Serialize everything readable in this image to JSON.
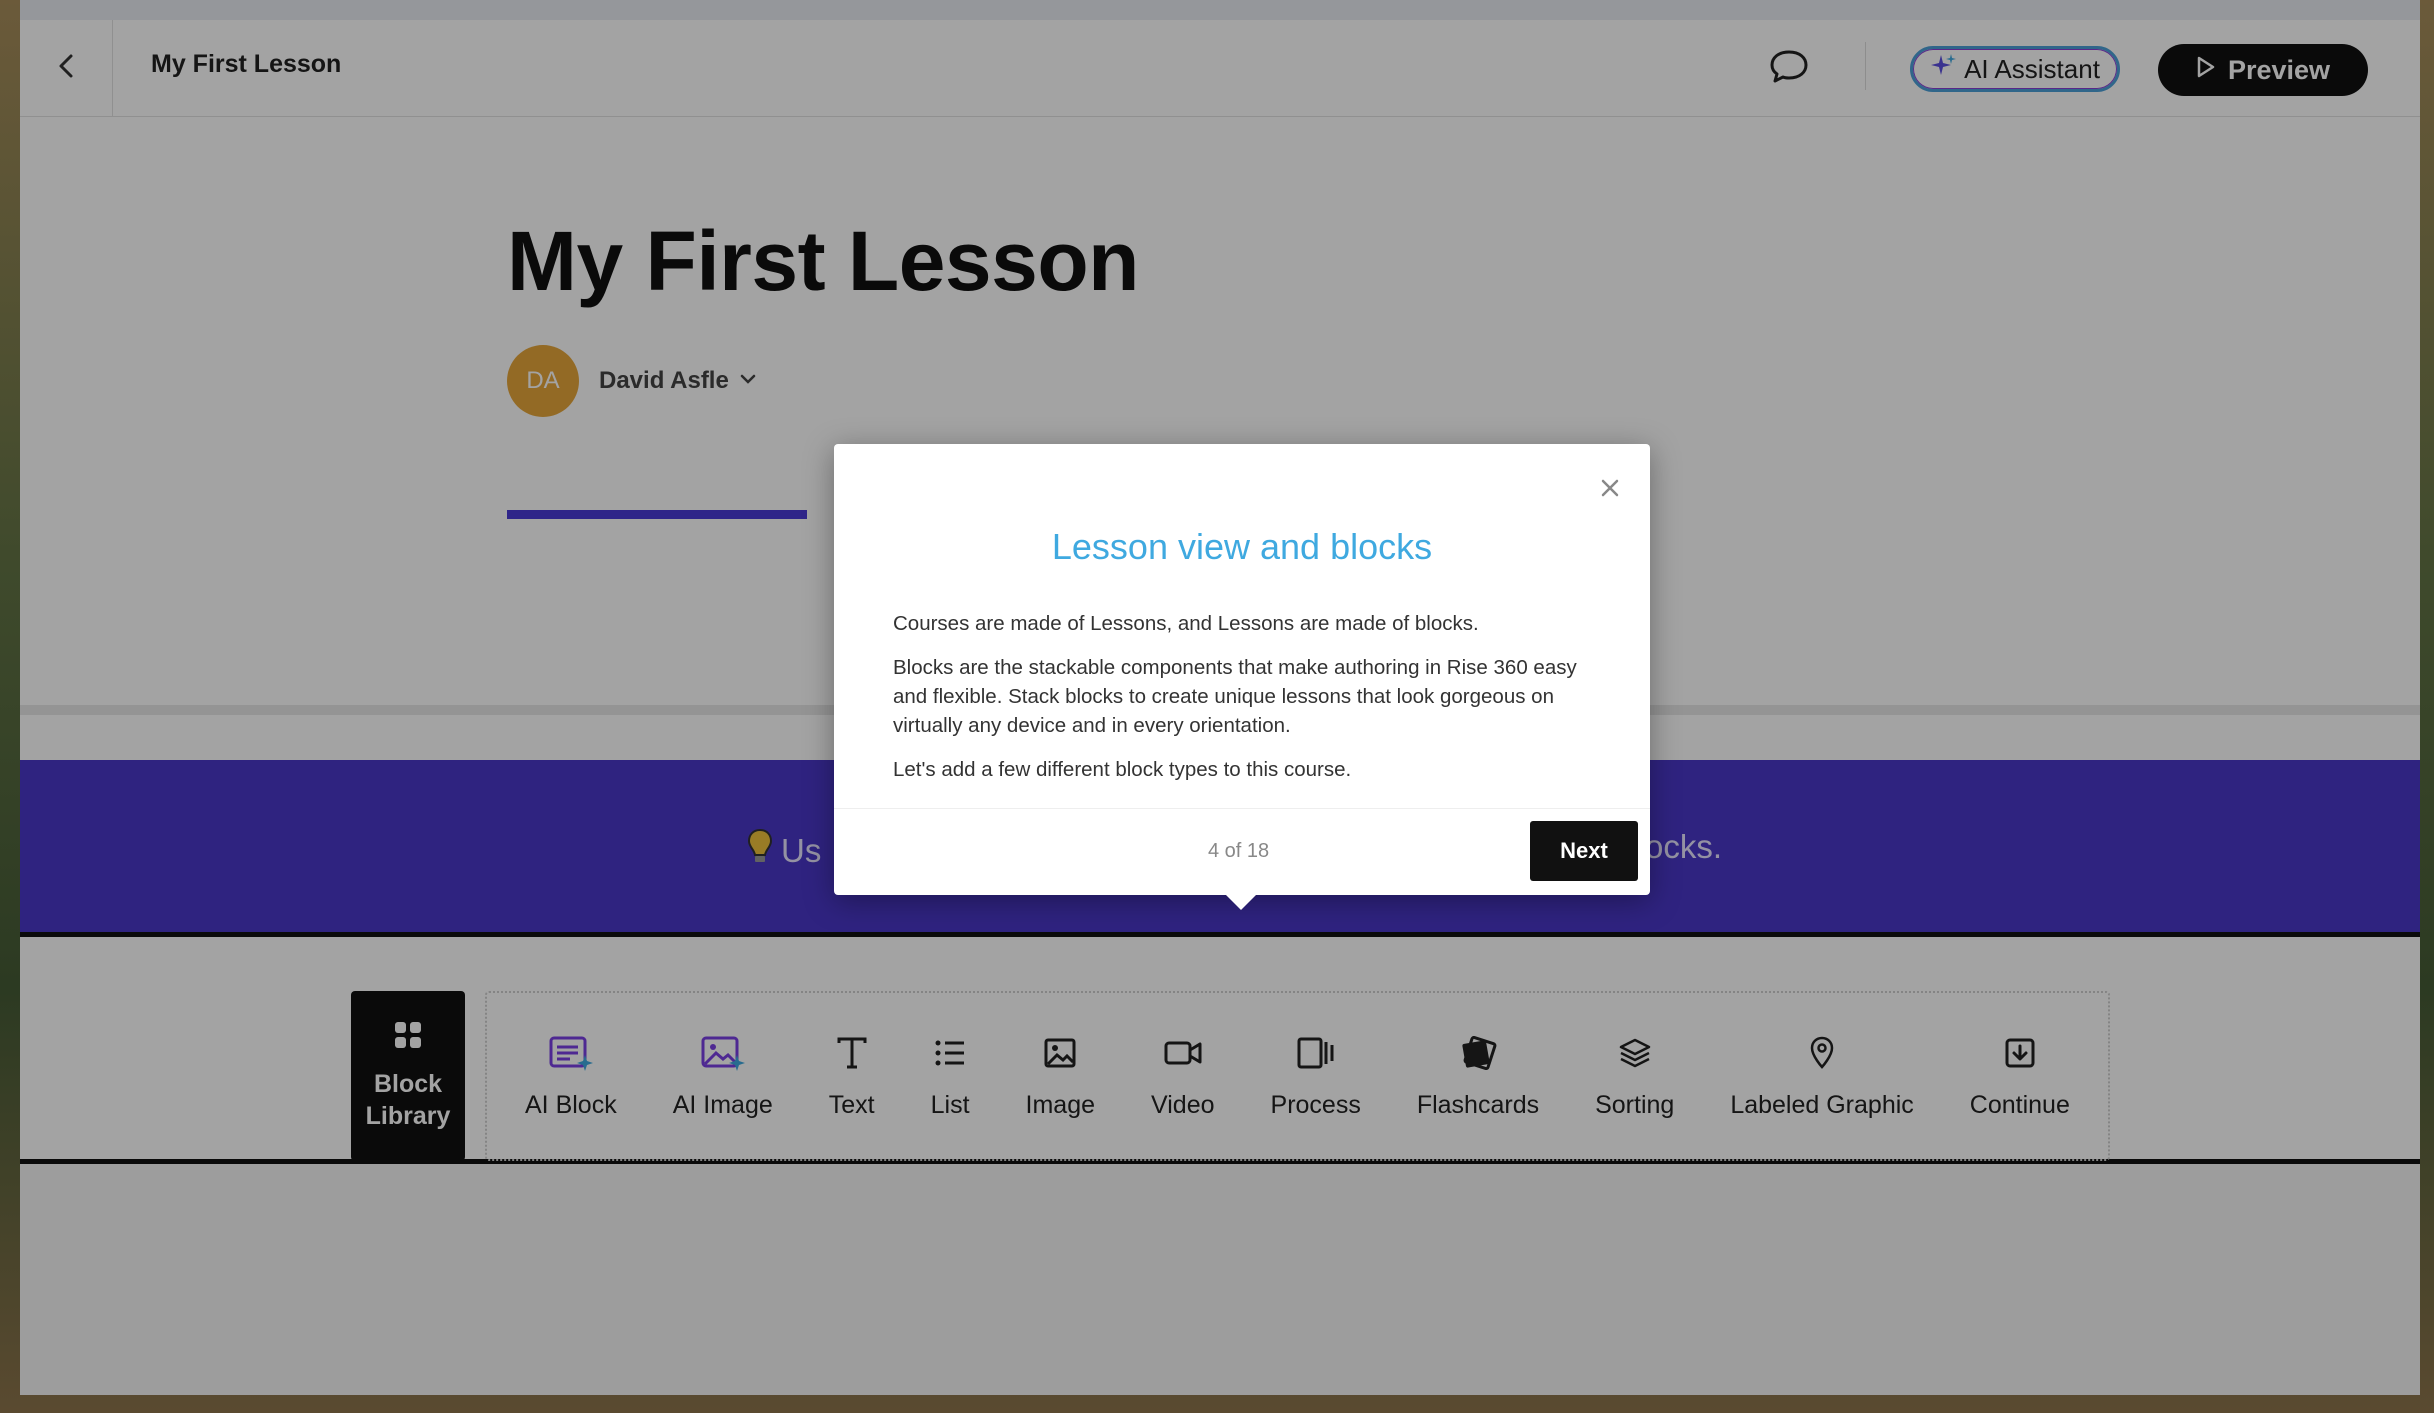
{
  "topbar": {
    "title": "My First Lesson",
    "ai_assistant_label": "AI Assistant",
    "preview_label": "Preview"
  },
  "lesson": {
    "title": "My First Lesson",
    "author_initials": "DA",
    "author_name": "David Asfle"
  },
  "banner": {
    "tip_start": "Us",
    "tip_end": "ocks."
  },
  "toolbar": {
    "block_library_label_1": "Block",
    "block_library_label_2": "Library",
    "blocks": [
      {
        "label": "AI Block",
        "icon": "ai-block-icon"
      },
      {
        "label": "AI Image",
        "icon": "ai-image-icon"
      },
      {
        "label": "Text",
        "icon": "text-icon"
      },
      {
        "label": "List",
        "icon": "list-icon"
      },
      {
        "label": "Image",
        "icon": "image-icon"
      },
      {
        "label": "Video",
        "icon": "video-icon"
      },
      {
        "label": "Process",
        "icon": "process-icon"
      },
      {
        "label": "Flashcards",
        "icon": "flashcards-icon"
      },
      {
        "label": "Sorting",
        "icon": "sorting-icon"
      },
      {
        "label": "Labeled Graphic",
        "icon": "labeled-graphic-icon"
      },
      {
        "label": "Continue",
        "icon": "continue-icon"
      }
    ]
  },
  "popup": {
    "title": "Lesson view and blocks",
    "paragraphs": [
      "Courses are made of Lessons, and Lessons are made of blocks.",
      "Blocks are the stackable components that make authoring in Rise 360 easy and flexible. Stack blocks to create unique lessons that look gorgeous on virtually any device and in every orientation.",
      "Let's add a few different block types to this course."
    ],
    "step": "4 of 18",
    "next_label": "Next"
  },
  "colors": {
    "accent_purple": "#4a38c8",
    "popup_title_blue": "#3fa9e0",
    "avatar_orange": "#e6a63a",
    "ai_icon_purple": "#7b3fe4"
  }
}
